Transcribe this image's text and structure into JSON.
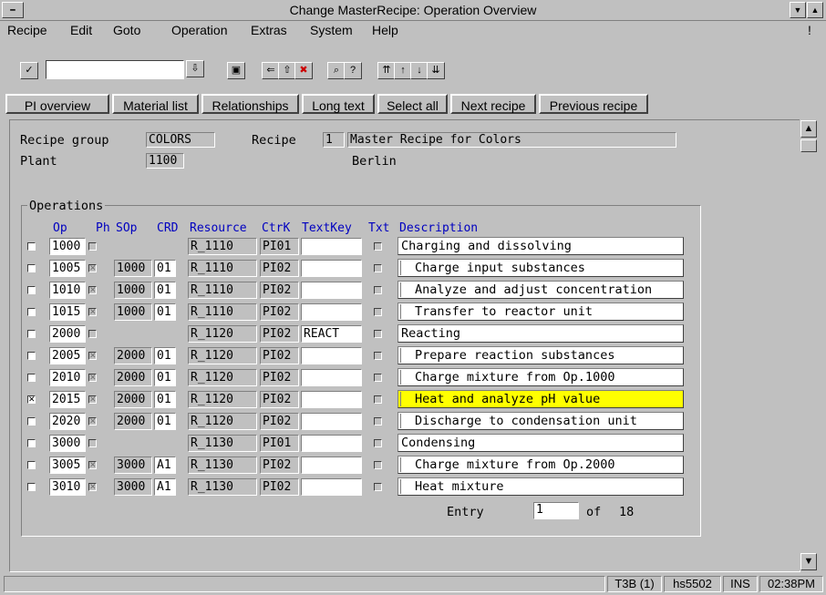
{
  "window": {
    "title": "Change MasterRecipe: Operation Overview"
  },
  "menu": [
    "Recipe",
    "Edit",
    "Goto",
    "Operation",
    "Extras",
    "System",
    "Help"
  ],
  "menu_right": "!",
  "buttons": [
    "PI overview",
    "Material list",
    "Relationships",
    "Long text",
    "Select all",
    "Next recipe",
    "Previous recipe"
  ],
  "header": {
    "recipe_group_label": "Recipe group",
    "recipe_group_value": "COLORS",
    "recipe_label": "Recipe",
    "recipe_value": "1",
    "recipe_desc": "Master Recipe for Colors",
    "plant_label": "Plant",
    "plant_value": "1100",
    "plant_name": "Berlin"
  },
  "operations": {
    "group_title": "Operations",
    "columns": [
      "Op",
      "Ph",
      "SOp",
      "CRD",
      "Resource",
      "CtrK",
      "TextKey",
      "Txt",
      "Description"
    ],
    "rows": [
      {
        "sel": "",
        "op": "1000",
        "ph": "",
        "sop": "",
        "crd": "",
        "res": "R_1110",
        "ctrk": "PI01",
        "textkey": "",
        "desc": "Charging and dissolving",
        "phase": false,
        "hl": false
      },
      {
        "sel": "",
        "op": "1005",
        "ph": "x",
        "sop": "1000",
        "crd": "01",
        "res": "R_1110",
        "ctrk": "PI02",
        "textkey": "",
        "desc": "Charge input substances",
        "phase": true,
        "hl": false
      },
      {
        "sel": "",
        "op": "1010",
        "ph": "x",
        "sop": "1000",
        "crd": "01",
        "res": "R_1110",
        "ctrk": "PI02",
        "textkey": "",
        "desc": "Analyze and adjust concentration",
        "phase": true,
        "hl": false
      },
      {
        "sel": "",
        "op": "1015",
        "ph": "x",
        "sop": "1000",
        "crd": "01",
        "res": "R_1110",
        "ctrk": "PI02",
        "textkey": "",
        "desc": "Transfer to reactor unit",
        "phase": true,
        "hl": false
      },
      {
        "sel": "",
        "op": "2000",
        "ph": "",
        "sop": "",
        "crd": "",
        "res": "R_1120",
        "ctrk": "PI02",
        "textkey": "REACT",
        "desc": "Reacting",
        "phase": false,
        "hl": false
      },
      {
        "sel": "",
        "op": "2005",
        "ph": "x",
        "sop": "2000",
        "crd": "01",
        "res": "R_1120",
        "ctrk": "PI02",
        "textkey": "",
        "desc": "Prepare reaction substances",
        "phase": true,
        "hl": false
      },
      {
        "sel": "",
        "op": "2010",
        "ph": "x",
        "sop": "2000",
        "crd": "01",
        "res": "R_1120",
        "ctrk": "PI02",
        "textkey": "",
        "desc": "Charge mixture from Op.1000",
        "phase": true,
        "hl": false
      },
      {
        "sel": "x",
        "op": "2015",
        "ph": "x",
        "sop": "2000",
        "crd": "01",
        "res": "R_1120",
        "ctrk": "PI02",
        "textkey": "",
        "desc": "Heat and analyze pH value",
        "phase": true,
        "hl": true
      },
      {
        "sel": "",
        "op": "2020",
        "ph": "x",
        "sop": "2000",
        "crd": "01",
        "res": "R_1120",
        "ctrk": "PI02",
        "textkey": "",
        "desc": "Discharge to condensation unit",
        "phase": true,
        "hl": false
      },
      {
        "sel": "",
        "op": "3000",
        "ph": "",
        "sop": "",
        "crd": "",
        "res": "R_1130",
        "ctrk": "PI01",
        "textkey": "",
        "desc": "Condensing",
        "phase": false,
        "hl": false
      },
      {
        "sel": "",
        "op": "3005",
        "ph": "x",
        "sop": "3000",
        "crd": "A1",
        "res": "R_1130",
        "ctrk": "PI02",
        "textkey": "",
        "desc": "Charge mixture from Op.2000",
        "phase": true,
        "hl": false
      },
      {
        "sel": "",
        "op": "3010",
        "ph": "x",
        "sop": "3000",
        "crd": "A1",
        "res": "R_1130",
        "ctrk": "PI02",
        "textkey": "",
        "desc": "Heat mixture",
        "phase": true,
        "hl": false
      }
    ],
    "entry_label": "Entry",
    "entry_value": "1",
    "of_label": "of",
    "total": "18"
  },
  "status": {
    "system": "T3B (1)",
    "host": "hs5502",
    "mode": "INS",
    "time": "02:38PM"
  }
}
